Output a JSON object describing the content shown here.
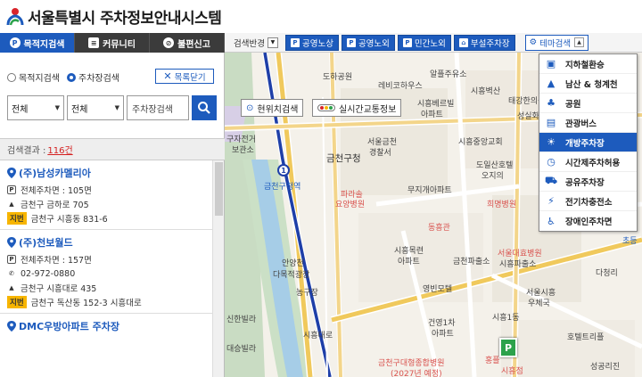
{
  "header": {
    "title": "서울특별시 주차정보안내시스템"
  },
  "tabs": [
    {
      "label": "목적지검색",
      "icon": "parking-icon"
    },
    {
      "label": "커뮤니티",
      "icon": "chat-icon"
    },
    {
      "label": "불편신고",
      "icon": "ban-icon"
    }
  ],
  "sidebar": {
    "radio_destination": "목적지검색",
    "radio_parking": "주차장검색",
    "close_label": "목록닫기",
    "filter1": "전체",
    "filter2": "전체",
    "search_placeholder": "주차장검색",
    "result_label": "검색결과 :",
    "result_count": "116건",
    "items": [
      {
        "name": "(주)남성카멜리아",
        "total": "전체주차면 : 105면",
        "address": "금천구 금하로 705",
        "badge": "지번",
        "jibun": "금천구 시흥동 831-6"
      },
      {
        "name": "(주)천보월드",
        "total": "전체주차면 : 157면",
        "phone": "02-972-0880",
        "address": "금천구 시흥대로 435",
        "badge": "지번",
        "jibun": "금천구 독산동 152-3 시흥대로"
      },
      {
        "name": "DMC우방아파트 주차장"
      }
    ]
  },
  "map_toolbar": {
    "view_label": "검색반경",
    "buttons": [
      "공영노상",
      "공영노외",
      "민간노외",
      "부설주차장"
    ],
    "theme_label": "테마검색"
  },
  "theme_menu": [
    {
      "label": "지하철환승",
      "icon": "subway-icon"
    },
    {
      "label": "남산 & 청계천",
      "icon": "mountain-icon"
    },
    {
      "label": "공원",
      "icon": "park-icon"
    },
    {
      "label": "관광버스",
      "icon": "bus-icon"
    },
    {
      "label": "개방주차장",
      "icon": "open-parking-icon",
      "active": true
    },
    {
      "label": "시간제주차허용",
      "icon": "clock-icon"
    },
    {
      "label": "공유주차장",
      "icon": "share-car-icon"
    },
    {
      "label": "전기차충전소",
      "icon": "ev-charger-icon"
    },
    {
      "label": "장애인주차면",
      "icon": "accessible-icon"
    }
  ],
  "map_controls": {
    "current_location": "현위치검색",
    "traffic": "실시간교통정보"
  },
  "map_labels": [
    "알플주유소",
    "도하공원",
    "레비코하우스",
    "시흥벽산",
    "태강한의원",
    "시흥베르빌",
    "아파트",
    "성실화",
    "구자전거",
    "보관소",
    "서울금천",
    "경찰서",
    "시흥중앙교회",
    "금천구청",
    "금천구청역",
    "도일산호텔",
    "오지의",
    "파라솔",
    "요양병원",
    "무지개아파트",
    "희명병원",
    "동흥관",
    "안양천",
    "다목적광장",
    "농구장",
    "시흥목련",
    "아파트",
    "금천파출소",
    "서울대효병원",
    "시흥파출소",
    "영빈모텔",
    "서울시흥",
    "우체국",
    "건영1차",
    "아파트",
    "시흥1동",
    "금천구대형종합병원",
    "(2027년 예정)",
    "대승빌라",
    "신한빌라",
    "시흥대로",
    "다청리",
    "호텔트리플",
    "성공리진",
    "초등",
    "홍플",
    "시흥점"
  ]
}
